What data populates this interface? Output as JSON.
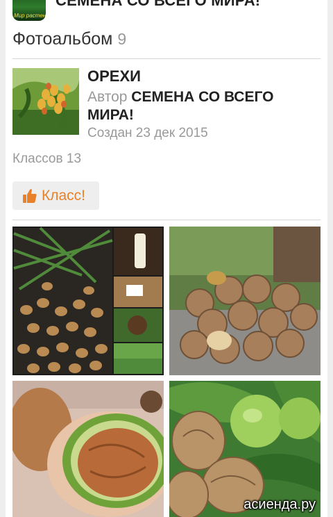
{
  "profile": {
    "name": "СЕМЕНА СО ВСЕГО МИРА!",
    "avatar_text": "Мир растений"
  },
  "album": {
    "header": "Фотоальбом",
    "photo_count": "9",
    "title": "ОРЕХИ",
    "author_prefix": "Автор",
    "author": "СЕМЕНА СО ВСЕГО МИРА!",
    "created": "Создан 23 дек 2015",
    "likes": "Классов 13",
    "like_button": "Класс!"
  },
  "photos": [
    {
      "name": "photo-tiger-nuts-collage"
    },
    {
      "name": "photo-walnuts-pile"
    },
    {
      "name": "photo-walnut-in-green-husk"
    },
    {
      "name": "photo-walnuts-with-green-fruits"
    }
  ],
  "watermark": "асиенда.ру",
  "colors": {
    "accent": "#e8812a",
    "muted": "#999999",
    "text": "#222222"
  }
}
